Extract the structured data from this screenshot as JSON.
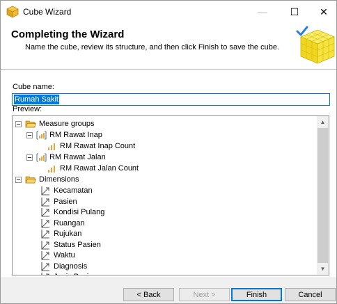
{
  "window": {
    "title": "Cube Wizard",
    "controls": {
      "minimize": "—",
      "maximize": "☐",
      "close": "✕"
    }
  },
  "header": {
    "title": "Completing the Wizard",
    "subtitle": "Name the cube, review its structure, and then click Finish to save the cube."
  },
  "form": {
    "cube_name_label": "Cube name:",
    "cube_name_value": "Rumah Sakit",
    "preview_label": "Preview:"
  },
  "tree": {
    "measure_groups": {
      "label": "Measure groups",
      "items": [
        {
          "label": "RM Rawat Inap",
          "measures": [
            "RM Rawat Inap Count"
          ]
        },
        {
          "label": "RM Rawat Jalan",
          "measures": [
            "RM Rawat Jalan Count"
          ]
        }
      ]
    },
    "dimensions": {
      "label": "Dimensions",
      "items": [
        "Kecamatan",
        "Pasien",
        "Kondisi Pulang",
        "Ruangan",
        "Rujukan",
        "Status Pasien",
        "Waktu",
        "Diagnosis",
        "Jenis Pasien"
      ]
    }
  },
  "buttons": {
    "back": "< Back",
    "next": "Next >",
    "finish": "Finish",
    "cancel": "Cancel"
  },
  "colors": {
    "accent": "#0078d7",
    "folder": "#f0c44a",
    "measure_bars": "#e8a33a",
    "cube": "#f5e13a"
  }
}
